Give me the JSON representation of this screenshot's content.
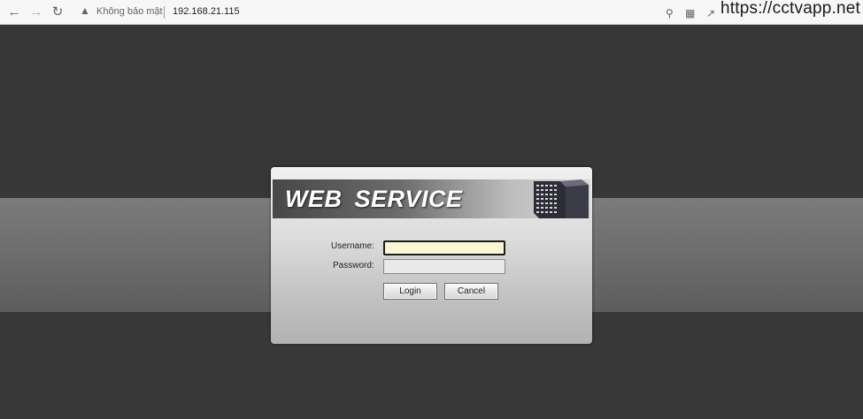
{
  "browser": {
    "security_label": "Không bảo mật",
    "url": "192.168.21.115",
    "watermark": "https://cctvapp.net"
  },
  "icons": {
    "back": "arrow-left-icon",
    "forward": "arrow-right-icon",
    "reload": "reload-icon",
    "warning": "warning-icon",
    "key": "key-icon",
    "translate": "translate-icon",
    "share": "share-icon"
  },
  "dialog": {
    "title": "WEB SERVICE",
    "username_label": "Username:",
    "password_label": "Password:",
    "username_value": "",
    "password_value": "",
    "login_label": "Login",
    "cancel_label": "Cancel"
  },
  "colors": {
    "page_background": "#383838",
    "middle_band": "#6e6e6e",
    "focused_input_background": "#fbf7d5"
  }
}
